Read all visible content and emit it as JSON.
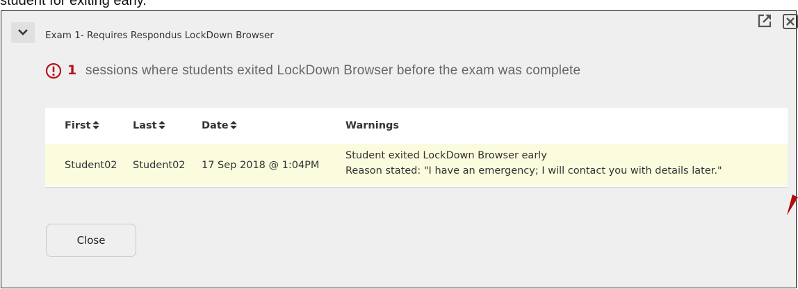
{
  "caption": "student for exiting early.",
  "dialog": {
    "exam_title": "Exam 1- Requires Respondus LockDown Browser",
    "popout_icon": "external-link-icon",
    "close_icon": "close-x-icon"
  },
  "summary": {
    "count": "1",
    "message": "sessions where students exited LockDown Browser before the exam was complete",
    "icon": "alert-circle-icon",
    "alert_color": "#b5121b"
  },
  "table": {
    "columns": [
      "First",
      "Last",
      "Date",
      "Warnings"
    ],
    "rows": [
      {
        "first": "Student02",
        "last": "Student02",
        "date": "17 Sep 2018 @ 1:04PM",
        "warning_line1": "Student exited LockDown Browser early",
        "warning_line2": "Reason stated: \"I have an emergency; I will contact you with details later.\""
      }
    ],
    "highlight_color": "#fbfbde"
  },
  "footer": {
    "close_label": "Close"
  }
}
